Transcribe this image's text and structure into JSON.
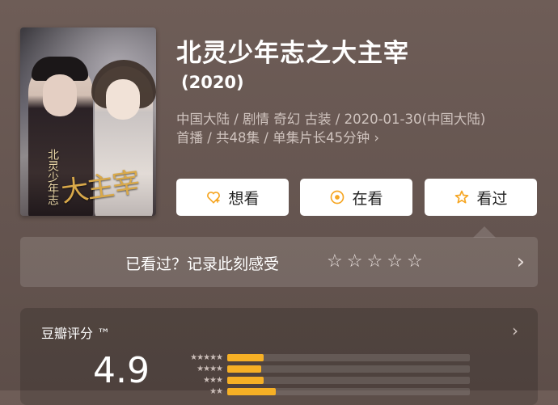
{
  "movie": {
    "title": "北灵少年志之大主宰",
    "year": "(2020)",
    "meta_line1": "中国大陆 / 剧情 奇幻 古装 / 2020-01-30(中国大陆)",
    "meta_line2": "首播 / 共48集 / 单集片长45分钟",
    "poster_calligraphy": "大主宰",
    "poster_subtitle": "北灵少年志"
  },
  "actions": {
    "want": "想看",
    "watching": "在看",
    "watched": "看过"
  },
  "watched_prompt": {
    "label": "已看过？记录此刻感受",
    "stars": [
      "☆",
      "☆",
      "☆",
      "☆",
      "☆"
    ]
  },
  "rating": {
    "title": "豆瓣评分 ™",
    "score": "4.9",
    "distribution": [
      {
        "stars": "★★★★★",
        "fraction": 0.15
      },
      {
        "stars": "★★★★",
        "fraction": 0.14
      },
      {
        "stars": "★★★",
        "fraction": 0.15
      },
      {
        "stars": "★★",
        "fraction": 0.2
      }
    ]
  },
  "colors": {
    "accent": "#f6b025",
    "icon_accent": "#f6a623"
  },
  "icons": {
    "want": "heart-plus-icon",
    "watching": "target-icon",
    "watched": "star-icon",
    "chevron": "chevron-right-icon"
  }
}
